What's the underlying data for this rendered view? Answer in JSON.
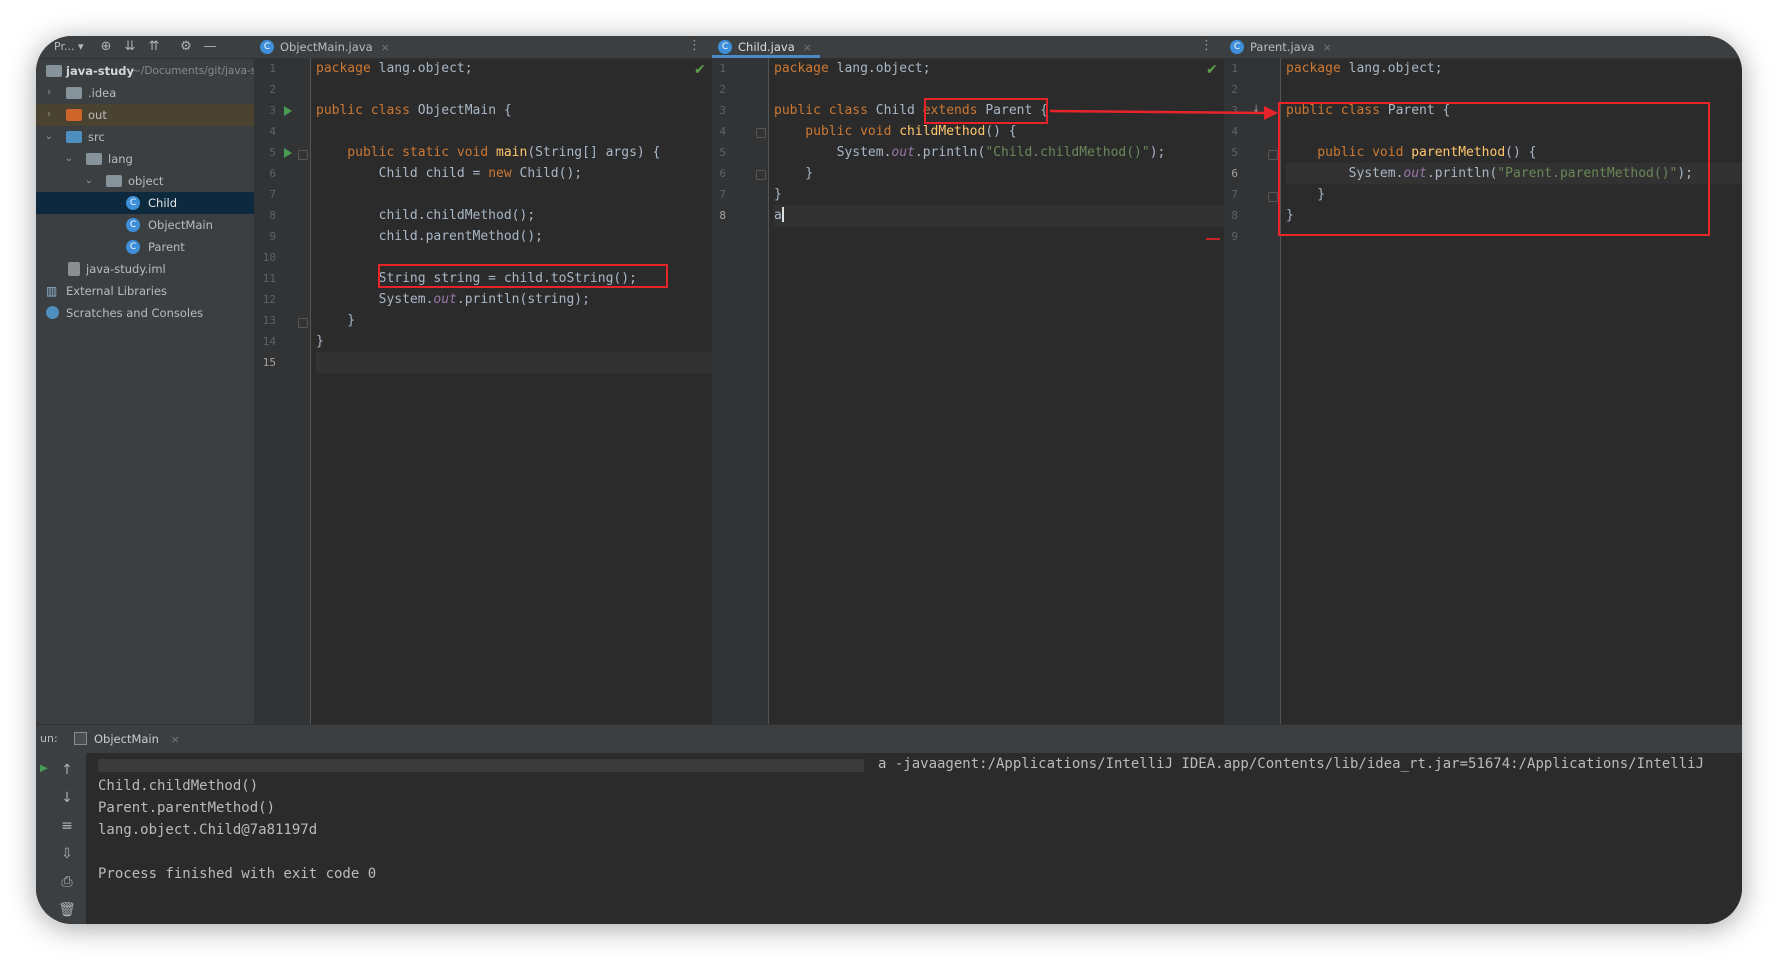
{
  "project": {
    "title": "Pr...",
    "items": [
      {
        "label": "java-study",
        "path": "~/Documents/git/java-study"
      },
      {
        "label": ".idea"
      },
      {
        "label": "out"
      },
      {
        "label": "src"
      },
      {
        "label": "lang"
      },
      {
        "label": "object"
      },
      {
        "label": "Child"
      },
      {
        "label": "ObjectMain"
      },
      {
        "label": "Parent"
      },
      {
        "label": "java-study.iml"
      },
      {
        "label": "External Libraries"
      },
      {
        "label": "Scratches and Consoles"
      }
    ]
  },
  "editors": {
    "objectmain": {
      "tab": "ObjectMain.java",
      "lines": [
        "1",
        "2",
        "3",
        "4",
        "5",
        "6",
        "7",
        "8",
        "9",
        "10",
        "11",
        "12",
        "13",
        "14",
        "15"
      ],
      "code": {
        "l1": [
          "package",
          " lang.object;"
        ],
        "l3": [
          "public class",
          " ObjectMain {"
        ],
        "l5": [
          "    public static void",
          " ",
          "main",
          "(String[] args) {"
        ],
        "l6": [
          "        Child child = ",
          "new",
          " Child();"
        ],
        "l8": [
          "        child.childMethod();"
        ],
        "l9": [
          "        child.parentMethod();"
        ],
        "l11": [
          "        String string = child.toString();"
        ],
        "l12": [
          "        System.",
          "out",
          ".println(string);"
        ],
        "l13": [
          "    }"
        ],
        "l14": [
          "}"
        ]
      }
    },
    "child": {
      "tab": "Child.java",
      "lines": [
        "1",
        "2",
        "3",
        "4",
        "5",
        "6",
        "7",
        "8"
      ],
      "code": {
        "l1": [
          "package",
          " lang.object;"
        ],
        "l3a": [
          "public class",
          " Child "
        ],
        "l3b": [
          "extends",
          " Parent"
        ],
        "l3c": [
          " {"
        ],
        "l4": [
          "    public void",
          " ",
          "childMethod",
          "() {"
        ],
        "l5": [
          "        System.",
          "out",
          ".println(",
          "\"Child.childMethod()\"",
          ");"
        ],
        "l6": [
          "    }"
        ],
        "l7": [
          "}"
        ],
        "l8": [
          "a"
        ]
      }
    },
    "parent": {
      "tab": "Parent.java",
      "lines": [
        "1",
        "2",
        "3",
        "4",
        "5",
        "6",
        "7",
        "8",
        "9"
      ],
      "code": {
        "l1": [
          "package",
          " lang.object;"
        ],
        "l3": [
          "public class",
          " Parent {"
        ],
        "l5": [
          "    public void",
          " ",
          "parentMethod",
          "() {"
        ],
        "l6": [
          "        System.",
          "out",
          ".println(",
          "\"Parent.parentMethod()\"",
          ");"
        ],
        "l7": [
          "    }"
        ],
        "l8": [
          "}"
        ]
      }
    }
  },
  "run": {
    "label": "un:",
    "tab": "ObjectMain",
    "command": "a -javaagent:/Applications/IntelliJ IDEA.app/Contents/lib/idea_rt.jar=51674:/Applications/IntelliJ",
    "output": [
      "Child.childMethod()",
      "Parent.parentMethod()",
      "lang.object.Child@7a81197d",
      "",
      "Process finished with exit code 0"
    ]
  },
  "colors": {
    "keyword": "#cc7832",
    "function": "#ffc66d",
    "string": "#6a8759",
    "static_field": "#9876aa",
    "annotation": "#e8242b"
  },
  "icons": [
    "gear-icon",
    "locate-icon",
    "expand-all-icon",
    "collapse-all-icon",
    "minimize-icon",
    "run-gutter-icon",
    "check-icon",
    "arrow-up-icon",
    "arrow-down-icon",
    "soft-wrap-icon",
    "scroll-to-end-icon",
    "print-icon",
    "trash-icon"
  ]
}
